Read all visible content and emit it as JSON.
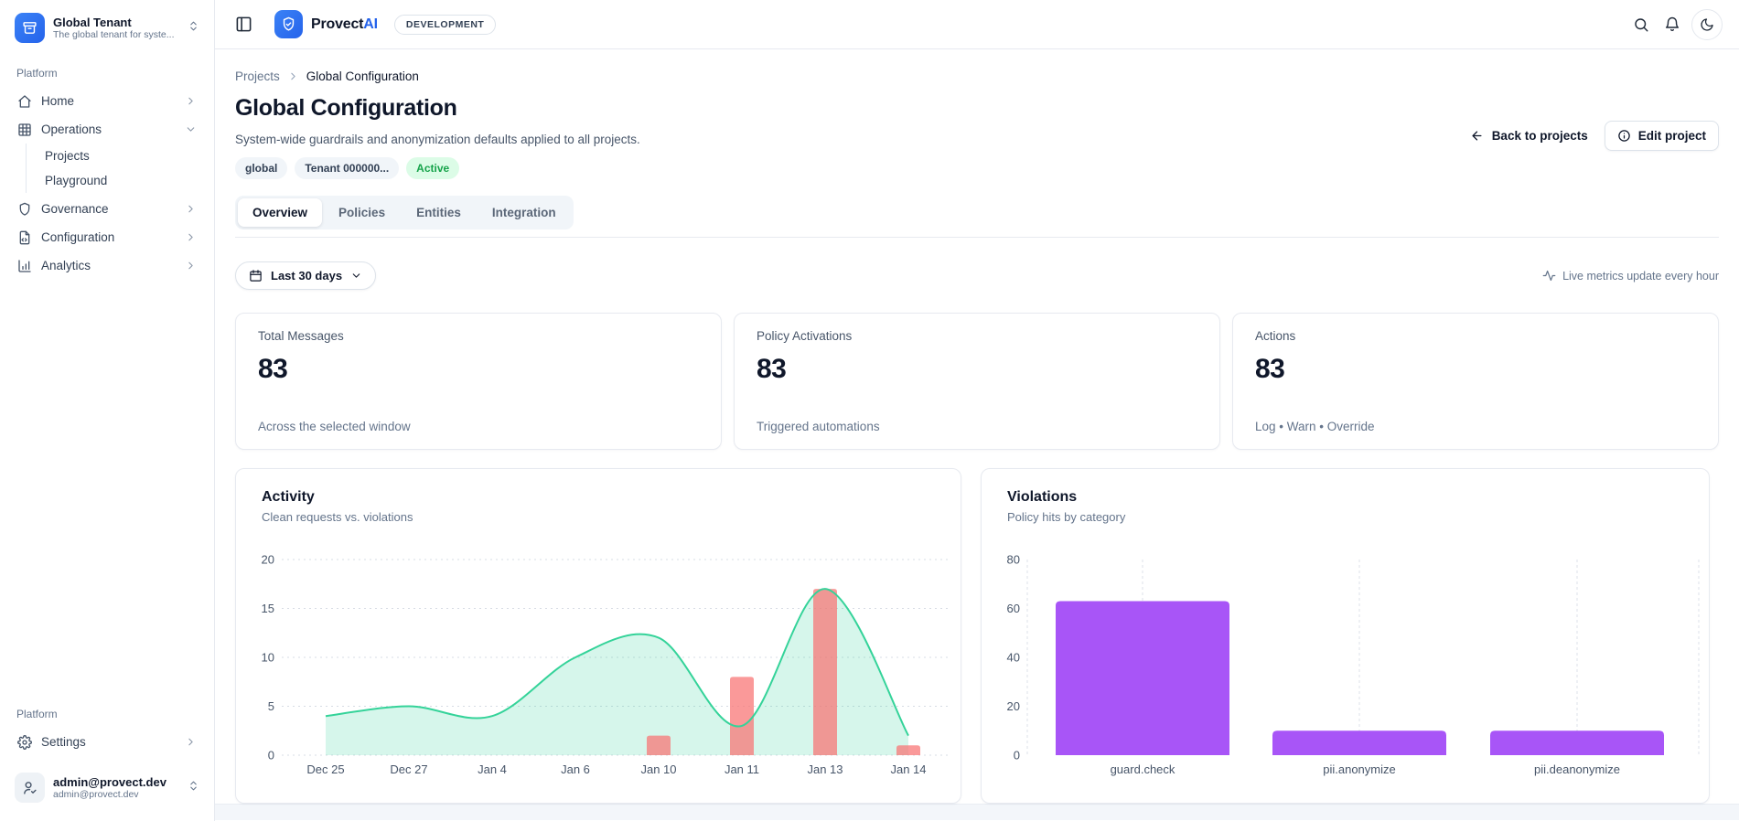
{
  "sidebar": {
    "tenant": {
      "name": "Global Tenant",
      "description": "The global tenant for syste..."
    },
    "platform_label": "Platform",
    "nav": [
      {
        "label": "Home"
      },
      {
        "label": "Operations",
        "children": [
          "Projects",
          "Playground"
        ]
      },
      {
        "label": "Governance"
      },
      {
        "label": "Configuration"
      },
      {
        "label": "Analytics"
      }
    ],
    "footer_label": "Platform",
    "settings_label": "Settings",
    "user": {
      "name": "admin@provect.dev",
      "email": "admin@provect.dev"
    }
  },
  "header": {
    "brand": {
      "name_primary": "Provect",
      "name_accent": "AI"
    },
    "environment_badge": "DEVELOPMENT"
  },
  "page": {
    "breadcrumb": {
      "parent": "Projects",
      "current": "Global Configuration"
    },
    "title": "Global Configuration",
    "subtitle": "System-wide guardrails and anonymization defaults applied to all projects.",
    "badges": [
      {
        "label": "global",
        "type": "neutral"
      },
      {
        "label": "Tenant 000000...",
        "type": "neutral"
      },
      {
        "label": "Active",
        "type": "success"
      }
    ],
    "actions": {
      "back": "Back to projects",
      "edit": "Edit project"
    },
    "tabs": [
      {
        "label": "Overview",
        "active": true
      },
      {
        "label": "Policies",
        "active": false
      },
      {
        "label": "Entities",
        "active": false
      },
      {
        "label": "Integration",
        "active": false
      }
    ]
  },
  "toolbar": {
    "range_label": "Last 30 days",
    "live_note": "Live metrics update every hour"
  },
  "stats": [
    {
      "title": "Total Messages",
      "value": "83",
      "note": "Across the selected window"
    },
    {
      "title": "Policy Activations",
      "value": "83",
      "note": "Triggered automations"
    },
    {
      "title": "Actions",
      "value": "83",
      "note": "Log • Warn • Override"
    }
  ],
  "chart_data": [
    {
      "type": "area",
      "title": "Activity",
      "subtitle": "Clean requests vs. violations",
      "x": [
        "Dec 25",
        "Dec 27",
        "Jan 4",
        "Jan 6",
        "Jan 10",
        "Jan 11",
        "Jan 13",
        "Jan 14"
      ],
      "series": [
        {
          "name": "Clean requests",
          "type": "area",
          "values": [
            4,
            5,
            4,
            10,
            12,
            3,
            17,
            2
          ],
          "color": "#34d399",
          "fill": "rgba(52,211,153,0.2)"
        },
        {
          "name": "Violations",
          "type": "bar",
          "values": [
            0,
            0,
            0,
            0,
            2,
            8,
            17,
            1
          ],
          "color": "rgba(248,113,113,0.72)"
        }
      ],
      "ylim": [
        0,
        20
      ],
      "yticks": [
        0,
        5,
        10,
        15,
        20
      ],
      "grid": "horizontal-dotted",
      "legend": "none"
    },
    {
      "type": "bar",
      "title": "Violations",
      "subtitle": "Policy hits by category",
      "categories": [
        "guard.check",
        "pii.anonymize",
        "pii.deanonymize"
      ],
      "values": [
        63,
        10,
        10
      ],
      "color": "#a855f7",
      "ylim": [
        0,
        80
      ],
      "yticks": [
        0,
        20,
        40,
        60,
        80
      ],
      "grid": "vertical-dashed",
      "legend": "none"
    }
  ]
}
